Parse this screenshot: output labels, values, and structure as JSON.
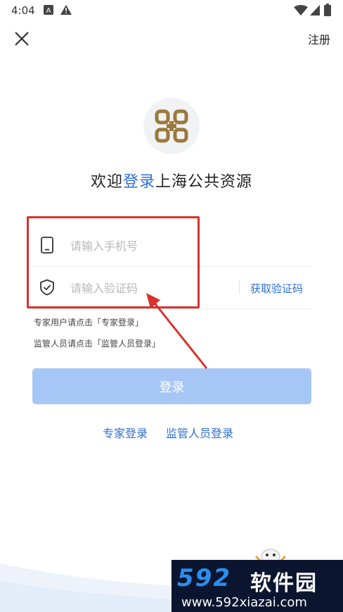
{
  "status_bar": {
    "time": "4:04",
    "icons": [
      "a-notification-icon",
      "warning-icon",
      "wifi-icon",
      "signal-icon",
      "battery-icon"
    ]
  },
  "nav": {
    "close_icon": "close-icon",
    "register_label": "注册"
  },
  "logo": {
    "icon": "logo-icon",
    "color": "#9a7a3e"
  },
  "welcome": {
    "prefix": "欢迎",
    "highlight": "登录",
    "suffix": "上海公共资源"
  },
  "form": {
    "phone": {
      "icon": "phone-icon",
      "placeholder": "请输入手机号",
      "value": ""
    },
    "code": {
      "icon": "shield-icon",
      "placeholder": "请输入验证码",
      "value": "",
      "get_code_label": "获取验证码"
    }
  },
  "hints": {
    "expert": "专家用户请点击「专家登录」",
    "supervisor": "监管人员请点击「监管人员登录」"
  },
  "login_button": {
    "label": "登录"
  },
  "links": {
    "expert": "专家登录",
    "supervisor": "监管人员登录"
  },
  "watermark": {
    "number": "592",
    "brand": "软件园",
    "url": "www.592xiazai.com"
  },
  "colors": {
    "accent": "#2f6fd4",
    "button_disabled": "#a6c7f6",
    "annotation": "#d8322c",
    "watermark_bg": "#0c1530"
  }
}
